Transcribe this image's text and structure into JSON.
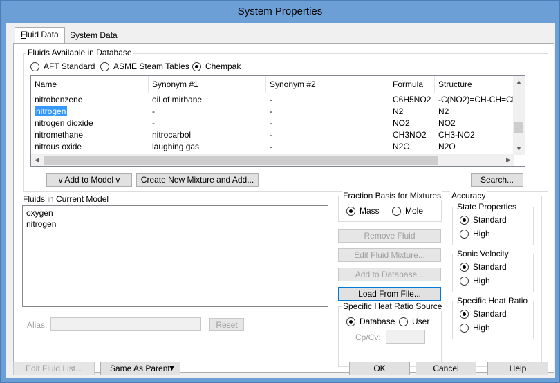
{
  "window": {
    "title": "System Properties"
  },
  "tabs": [
    {
      "label": "Fluid Data",
      "underline": "F",
      "rest": "luid Data"
    },
    {
      "label": "System Data",
      "underline": "S",
      "rest": "ystem Data"
    }
  ],
  "database": {
    "legend": "Fluids Available in Database",
    "sources": [
      {
        "label": "AFT Standard",
        "selected": false
      },
      {
        "label": "ASME Steam Tables",
        "selected": false
      },
      {
        "label": "Chempak",
        "selected": true
      }
    ],
    "columns": [
      "Name",
      "Synonym #1",
      "Synonym #2",
      "Formula",
      "Structure"
    ],
    "rows": [
      [
        "nitrobenzene",
        "oil of mirbane",
        "-",
        "C6H5NO2",
        "-C(NO2)=CH-CH=CH-C"
      ],
      [
        "nitrogen",
        "-",
        "-",
        "N2",
        "N2"
      ],
      [
        "nitrogen dioxide",
        "-",
        "-",
        "NO2",
        "NO2"
      ],
      [
        "nitromethane",
        "nitrocarbol",
        "-",
        "CH3NO2",
        "CH3-NO2"
      ],
      [
        "nitrous oxide",
        "laughing gas",
        "-",
        "N2O",
        "N2O"
      ]
    ],
    "selected_row": 1
  },
  "buttons": {
    "add_to_model": "v  Add to Model  v",
    "create_mixture": "Create New Mixture and Add...",
    "search": "Search...",
    "remove_fluid": "Remove Fluid",
    "edit_mixture": "Edit Fluid Mixture...",
    "add_to_database": "Add to Database...",
    "load_from_file": "Load From File...",
    "reset": "Reset",
    "edit_fluid_list": "Edit Fluid List...",
    "same_as_parent": "Same As Parent",
    "ok": "OK",
    "cancel": "Cancel",
    "help": "Help"
  },
  "current_model": {
    "label": "Fluids in Current Model",
    "items": [
      "oxygen",
      "nitrogen"
    ]
  },
  "alias": {
    "label": "Alias:",
    "value": ""
  },
  "fraction_basis": {
    "legend": "Fraction Basis for Mixtures",
    "options": [
      {
        "label": "Mass",
        "selected": true
      },
      {
        "label": "Mole",
        "selected": false
      }
    ]
  },
  "specific_heat_source": {
    "legend": "Specific Heat Ratio Source",
    "options": [
      {
        "label": "Database",
        "selected": true
      },
      {
        "label": "User",
        "selected": false
      }
    ],
    "cpcv_label": "Cp/Cv:",
    "cpcv_value": ""
  },
  "accuracy": {
    "legend": "Accuracy",
    "groups": [
      {
        "legend": "State Properties",
        "options": [
          {
            "label": "Standard",
            "selected": true
          },
          {
            "label": "High",
            "selected": false
          }
        ]
      },
      {
        "legend": "Sonic Velocity",
        "options": [
          {
            "label": "Standard",
            "selected": true
          },
          {
            "label": "High",
            "selected": false
          }
        ]
      },
      {
        "legend": "Specific Heat Ratio",
        "options": [
          {
            "label": "Standard",
            "selected": true
          },
          {
            "label": "High",
            "selected": false
          }
        ]
      }
    ]
  }
}
